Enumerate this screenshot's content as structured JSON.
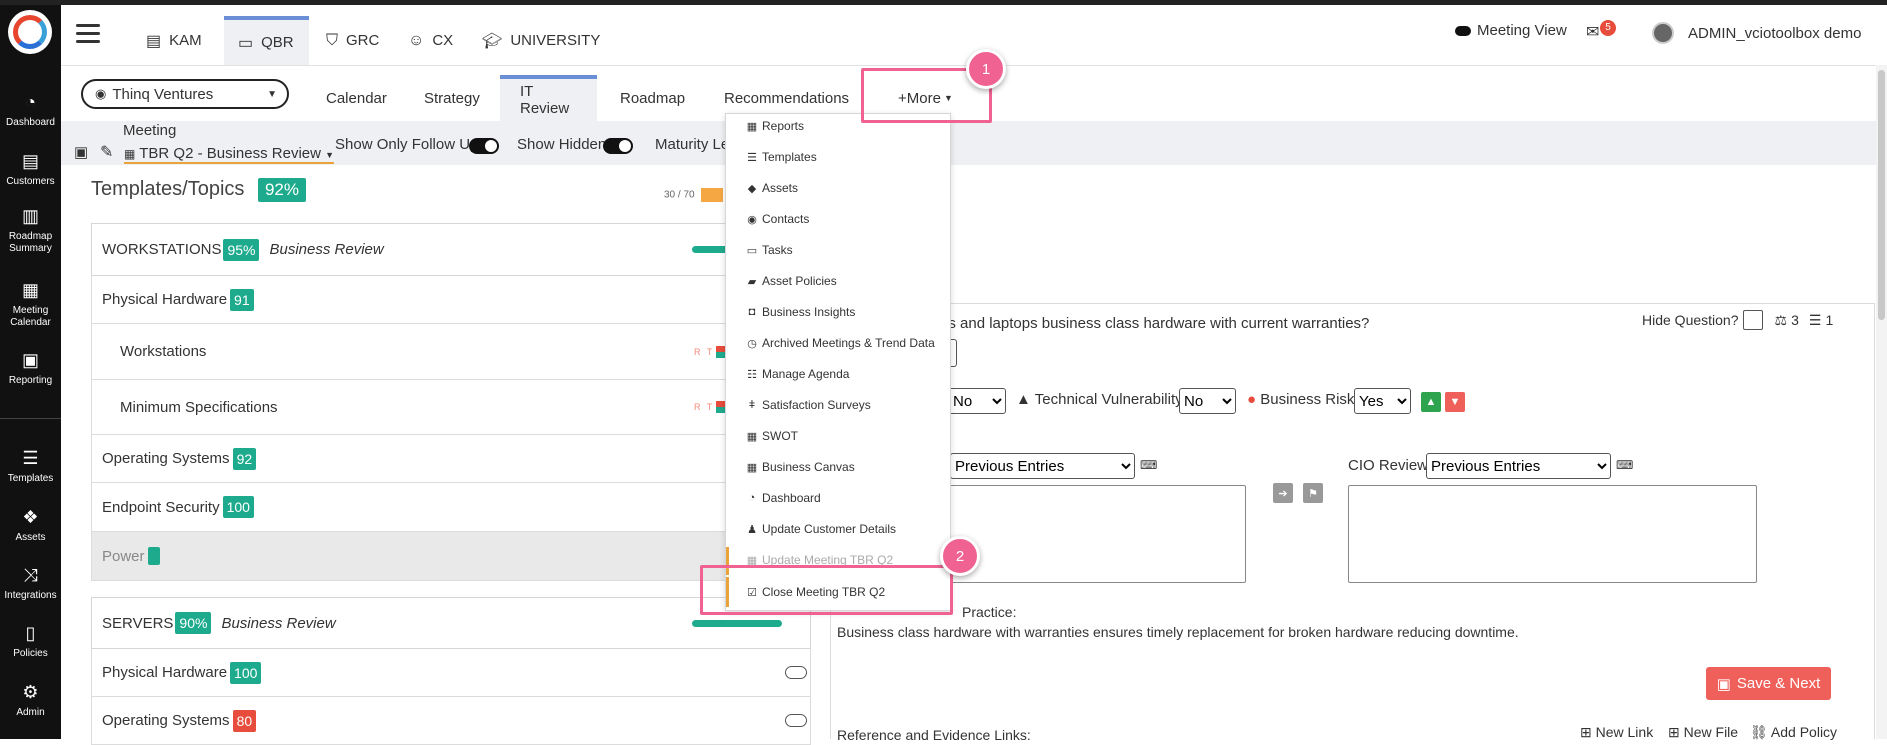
{
  "header": {
    "tabs": [
      {
        "label": "KAM",
        "icon": "id-card-icon"
      },
      {
        "label": "QBR",
        "icon": "laptop-icon"
      },
      {
        "label": "GRC",
        "icon": "shield-icon"
      },
      {
        "label": "CX",
        "icon": "smile-icon"
      },
      {
        "label": "UNIVERSITY",
        "icon": "graduation-cap-icon"
      }
    ],
    "meeting_view": "Meeting View",
    "mail_count": "5",
    "user": "ADMIN_vciotoolbox demo"
  },
  "sidebar": {
    "items": [
      "Dashboard",
      "Customers",
      "Roadmap Summary",
      "Meeting Calendar",
      "Reporting",
      "Templates",
      "Assets",
      "Integrations",
      "Policies",
      "Admin"
    ]
  },
  "company": {
    "selected": "Thinq Ventures"
  },
  "subtabs": [
    "Calendar",
    "Strategy",
    "IT Review",
    "Roadmap",
    "Recommendations",
    "+More"
  ],
  "toolbar": {
    "meeting_label": "Meeting",
    "meeting_value": "TBR Q2 - Business Review",
    "follow_up": "Show Only Follow Up",
    "show_hidden": "Show Hidden",
    "maturity": "Maturity Le"
  },
  "left": {
    "title": "Templates/Topics",
    "title_pct": "92%",
    "progress_text": "30 / 70",
    "workstations": {
      "name": "WORKSTATIONS",
      "pct": "95%",
      "type": "Business Review"
    },
    "ws_rows": [
      {
        "name": "Physical Hardware",
        "score": "91"
      },
      {
        "name": "Workstations"
      },
      {
        "name": "Minimum Specifications"
      },
      {
        "name": "Operating Systems",
        "score": "92"
      },
      {
        "name": "Endpoint Security",
        "score": "100"
      },
      {
        "name": "Power"
      }
    ],
    "rt": "R T",
    "servers": {
      "name": "SERVERS",
      "pct": "90%",
      "type": "Business Review"
    },
    "srv_rows": [
      {
        "name": "Physical Hardware",
        "score": "100"
      },
      {
        "name": "Operating Systems",
        "score": "80"
      }
    ]
  },
  "right": {
    "question": "ns and laptops business class hardware with current warranties?",
    "hide_question": "Hide Question?",
    "count_a": "3",
    "count_b": "1",
    "no_value": "No",
    "tech_vuln_label": "Technical Vulnerability:",
    "tech_vuln_value": "No",
    "biz_risk_label": "Business Risk:",
    "biz_risk_value": "Yes",
    "prev_entries": "Previous Entries",
    "cio_review": "CIO Review",
    "practice_label": "Practice:",
    "practice_text": "Business class hardware with warranties ensures timely replacement for broken hardware reducing downtime.",
    "save_next": "Save & Next",
    "ref_links": "Reference and Evidence Links:",
    "new_link": "New Link",
    "new_file": "New File",
    "add_policy": "Add Policy"
  },
  "menu": {
    "items": [
      {
        "label": "Reports",
        "icon": "grid-icon"
      },
      {
        "label": "Templates",
        "icon": "list-icon"
      },
      {
        "label": "Assets",
        "icon": "cube-icon"
      },
      {
        "label": "Contacts",
        "icon": "user-circle-icon"
      },
      {
        "label": "Tasks",
        "icon": "calendar-icon"
      },
      {
        "label": "Asset Policies",
        "icon": "book-icon"
      },
      {
        "label": "Business Insights",
        "icon": "car-icon"
      },
      {
        "label": "Archived Meetings & Trend Data",
        "icon": "clock-icon"
      },
      {
        "label": "Manage Agenda",
        "icon": "list-ol-icon"
      },
      {
        "label": "Satisfaction Surveys",
        "icon": "thermometer-icon"
      },
      {
        "label": "SWOT",
        "icon": "grid-icon"
      },
      {
        "label": "Business Canvas",
        "icon": "grid-icon"
      },
      {
        "label": "Dashboard",
        "icon": "tachometer-icon"
      },
      {
        "label": "Update Customer Details",
        "icon": "user-icon"
      },
      {
        "label": "Update Meeting TBR Q2",
        "icon": "calendar-icon"
      },
      {
        "label": "Close Meeting TBR Q2",
        "icon": "check-square-icon"
      }
    ]
  },
  "callouts": [
    "1",
    "2"
  ]
}
